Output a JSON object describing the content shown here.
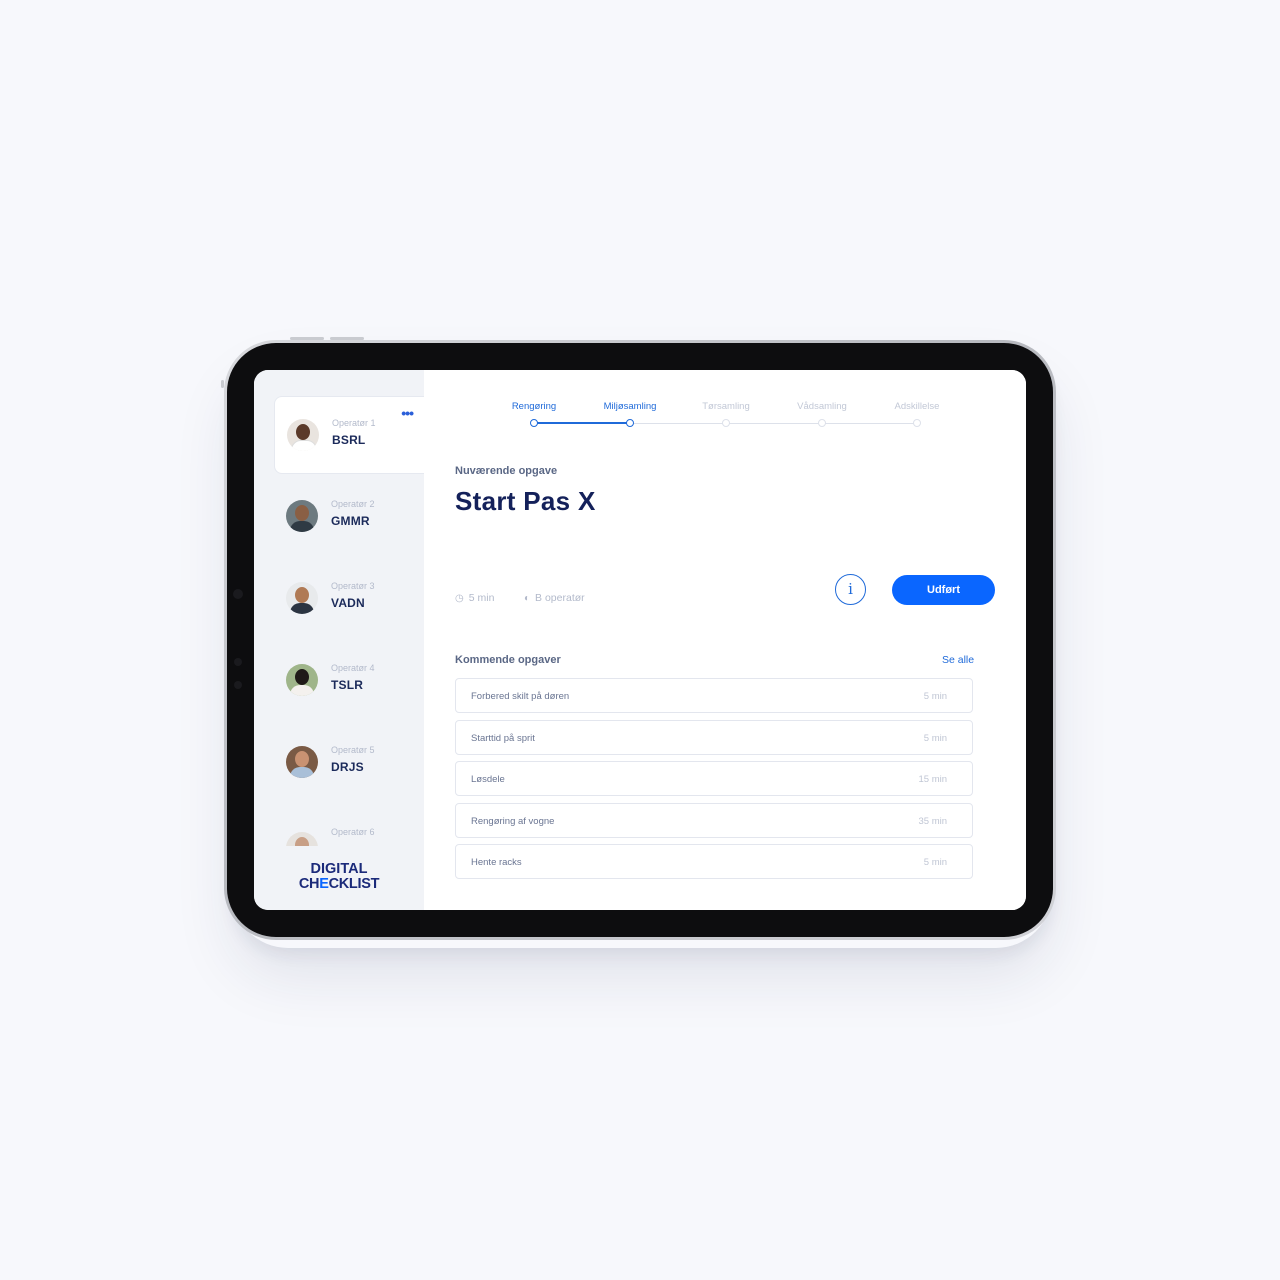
{
  "sidebar": {
    "operators": [
      {
        "role": "Operatør 1",
        "name": "BSRL",
        "active": true
      },
      {
        "role": "Operatør 2",
        "name": "GMMR"
      },
      {
        "role": "Operatør 3",
        "name": "VADN"
      },
      {
        "role": "Operatør 4",
        "name": "TSLR"
      },
      {
        "role": "Operatør 5",
        "name": "DRJS"
      },
      {
        "role": "Operatør 6",
        "name": ""
      }
    ],
    "more_icon": "•••",
    "logo": {
      "line1": "DIGITAL",
      "line2a": "CH",
      "line2b": "E",
      "line2c": "CKLIST"
    }
  },
  "stepper": {
    "steps": [
      "Rengøring",
      "Miljøsamling",
      "Tørsamling",
      "Vådsamling",
      "Adskillelse"
    ],
    "completed_count": 1,
    "current_index": 1
  },
  "current_task": {
    "label": "Nuværende opgave",
    "title": "Start Pas X",
    "duration": "5 min",
    "operators": "B operatør",
    "info_label": "i",
    "done_label": "Udført"
  },
  "upcoming": {
    "label": "Kommende opgaver",
    "see_all": "Se alle",
    "tasks": [
      {
        "name": "Forbered skilt på døren",
        "duration": "5 min"
      },
      {
        "name": "Starttid på sprit",
        "duration": "5 min"
      },
      {
        "name": "Løsdele",
        "duration": "15 min"
      },
      {
        "name": "Rengøring af vogne",
        "duration": "35 min"
      },
      {
        "name": "Hente racks",
        "duration": "5 min"
      }
    ]
  },
  "colors": {
    "accent": "#0a66ff",
    "navy": "#14215a",
    "sidebar_bg": "#f1f3f7",
    "page_bg": "#f7f8fc"
  }
}
